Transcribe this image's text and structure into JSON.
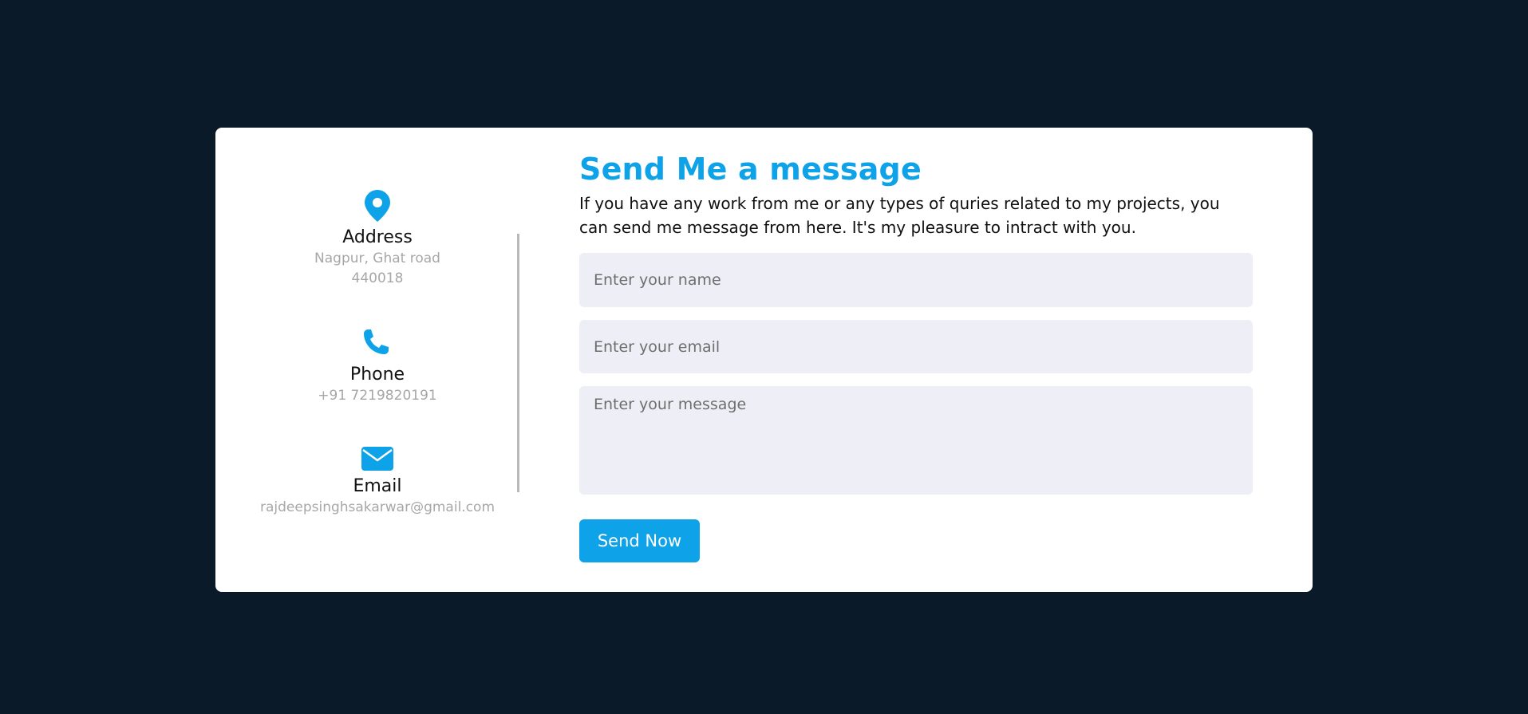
{
  "contact_info": {
    "address": {
      "icon": "map-pin-icon",
      "title": "Address",
      "line1": "Nagpur, Ghat road",
      "line2": "440018"
    },
    "phone": {
      "icon": "phone-icon",
      "title": "Phone",
      "value": "+91 7219820191"
    },
    "email": {
      "icon": "envelope-icon",
      "title": "Email",
      "value": "rajdeepsinghsakarwar@gmail.com"
    }
  },
  "form": {
    "heading": "Send Me a message",
    "intro": "If you have any work from me or any types of quries related to my projects, you can send me message from here. It's my pleasure to intract with you.",
    "name_placeholder": "Enter your name",
    "email_placeholder": "Enter your email",
    "message_placeholder": "Enter your message",
    "submit_label": "Send Now"
  },
  "colors": {
    "accent": "#0ea2e8",
    "background": "#0a1a28",
    "card": "#ffffff",
    "field_bg": "#eeeff6",
    "muted_text": "#a7a7a7"
  }
}
